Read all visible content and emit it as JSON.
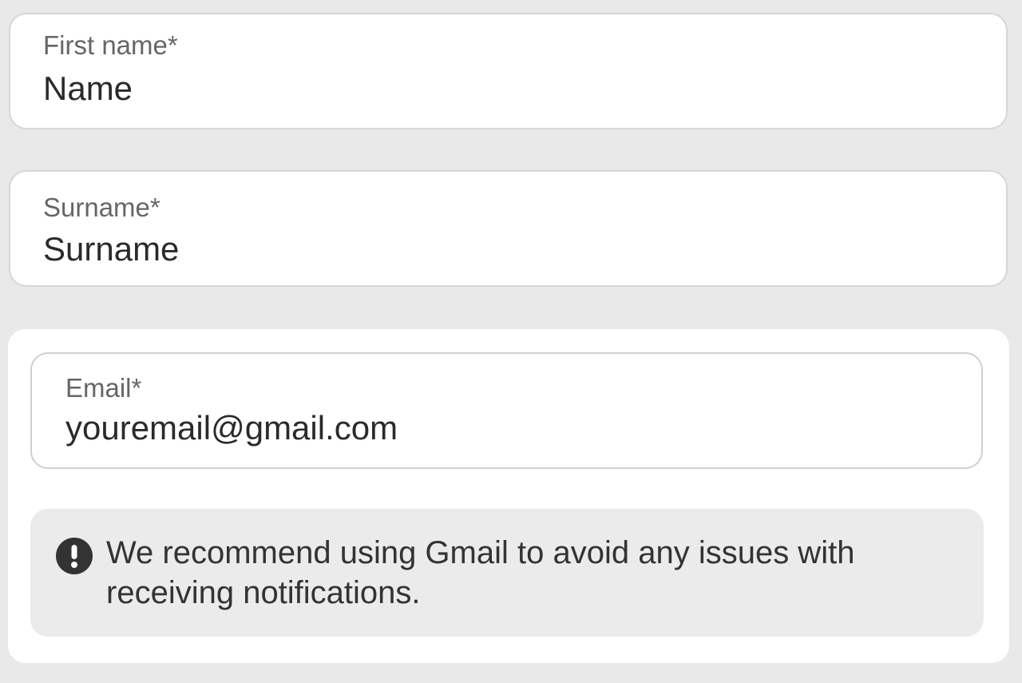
{
  "form": {
    "first_name": {
      "label": "First name*",
      "value": "Name"
    },
    "surname": {
      "label": "Surname*",
      "value": "Surname"
    },
    "email": {
      "label": "Email*",
      "value": "youremail@gmail.com"
    },
    "notice": {
      "icon": "exclamation-circle-icon",
      "text": "We recommend using Gmail to avoid any issues with receiving notifications."
    }
  },
  "colors": {
    "page_background": "#e9e9e9",
    "field_background": "#ffffff",
    "notice_background": "#ebebeb",
    "label_text": "#666666",
    "value_text": "#2a2a2a"
  }
}
